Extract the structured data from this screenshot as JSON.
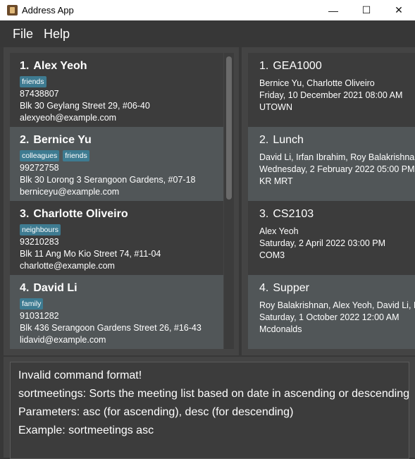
{
  "window": {
    "title": "Address App",
    "controls": {
      "minimize": "—",
      "maximize": "☐",
      "close": "✕"
    }
  },
  "menu": {
    "file": "File",
    "help": "Help"
  },
  "persons": [
    {
      "index": "1.",
      "name": "Alex Yeoh",
      "tags": [
        "friends"
      ],
      "phone": "87438807",
      "address": "Blk 30 Geylang Street 29, #06-40",
      "email": "alexyeoh@example.com"
    },
    {
      "index": "2.",
      "name": "Bernice Yu",
      "tags": [
        "colleagues",
        "friends"
      ],
      "phone": "99272758",
      "address": "Blk 30 Lorong 3 Serangoon Gardens, #07-18",
      "email": "berniceyu@example.com"
    },
    {
      "index": "3.",
      "name": "Charlotte Oliveiro",
      "tags": [
        "neighbours"
      ],
      "phone": "93210283",
      "address": "Blk 11 Ang Mo Kio Street 74, #11-04",
      "email": "charlotte@example.com"
    },
    {
      "index": "4.",
      "name": "David Li",
      "tags": [
        "family"
      ],
      "phone": "91031282",
      "address": "Blk 436 Serangoon Gardens Street 26, #16-43",
      "email": "lidavid@example.com"
    }
  ],
  "meetings": [
    {
      "index": "1.",
      "title": "GEA1000",
      "people": "Bernice Yu, Charlotte Oliveiro",
      "datetime": "Friday, 10 December 2021 08:00 AM",
      "location": "UTOWN"
    },
    {
      "index": "2.",
      "title": "Lunch",
      "people": "David Li, Irfan Ibrahim, Roy Balakrishnan",
      "datetime": "Wednesday, 2 February 2022 05:00 PM",
      "location": "KR MRT"
    },
    {
      "index": "3.",
      "title": "CS2103",
      "people": "Alex Yeoh",
      "datetime": "Saturday, 2 April 2022 03:00 PM",
      "location": "COM3"
    },
    {
      "index": "4.",
      "title": "Supper",
      "people": "Roy Balakrishnan, Alex Yeoh, David Li, Irfan Ibrahim",
      "datetime": "Saturday, 1 October 2022 12:00 AM",
      "location": "Mcdonalds"
    }
  ],
  "result": {
    "lines": [
      "Invalid command format!",
      "sortmeetings: Sorts the meeting list based on date in ascending or descending order.",
      "Parameters: asc (for ascending), desc (for descending)",
      "Example: sortmeetings asc"
    ]
  },
  "colors": {
    "tag": "#3e7b91",
    "selected_card": "#515658",
    "background": "#383838"
  }
}
